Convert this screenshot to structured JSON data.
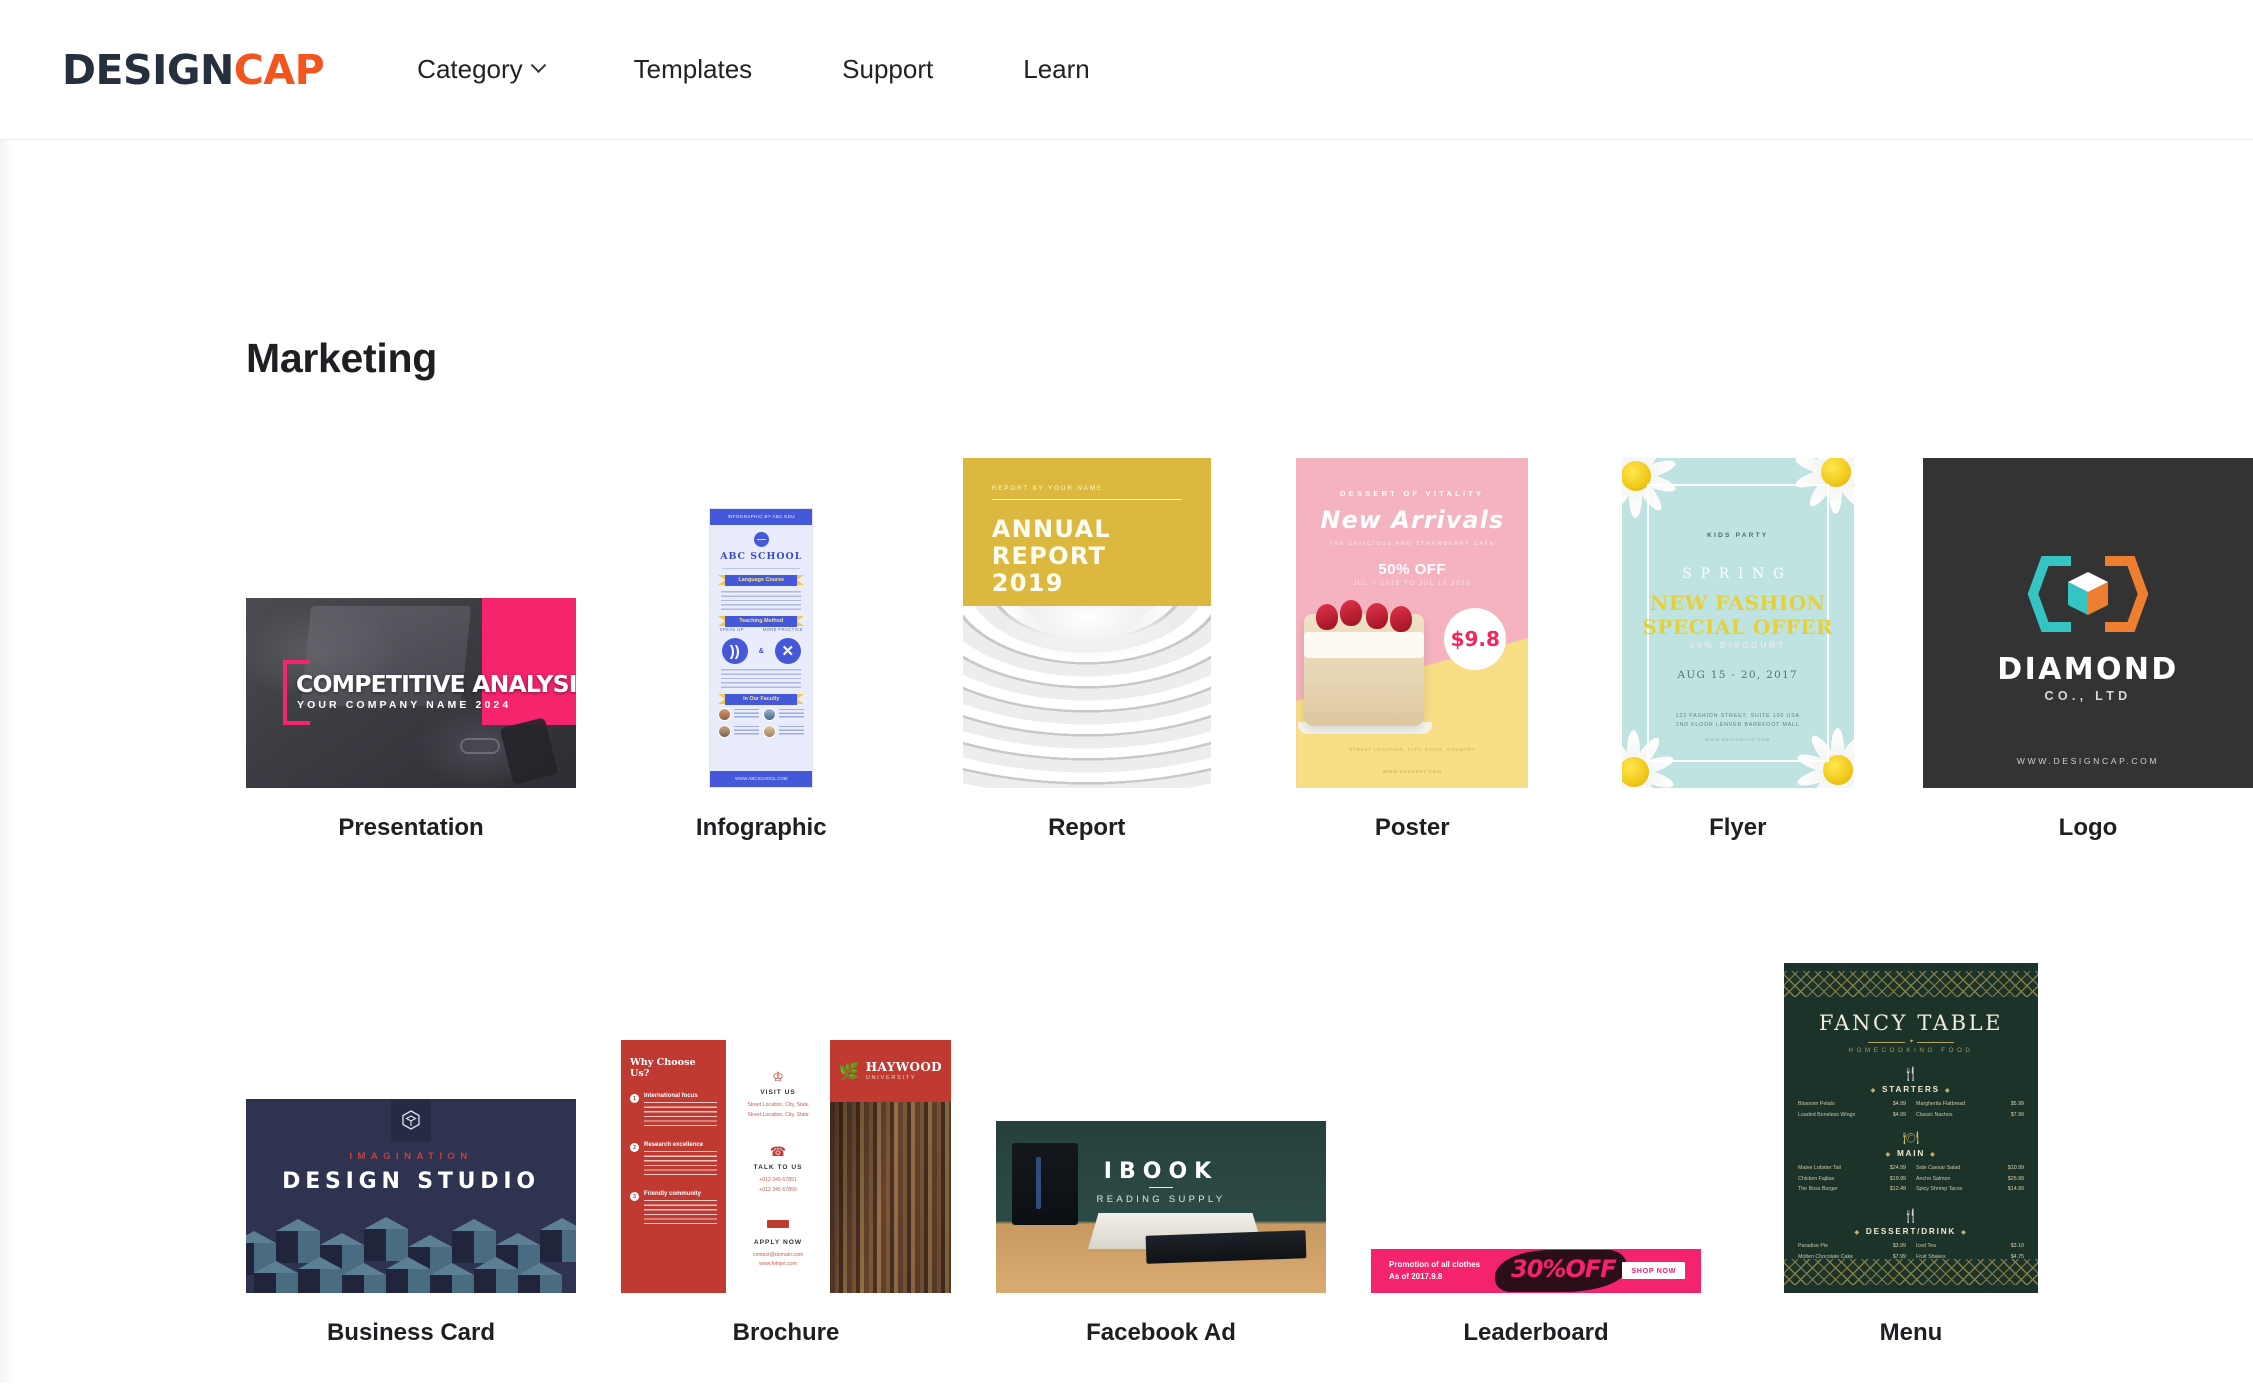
{
  "header": {
    "logo": {
      "part1": "DESIGN",
      "part2": "CAP",
      "color1": "#262f3d",
      "color2": "#f4551f"
    },
    "nav": [
      {
        "label": "Category",
        "has_caret": true
      },
      {
        "label": "Templates",
        "has_caret": false
      },
      {
        "label": "Support",
        "has_caret": false
      },
      {
        "label": "Learn",
        "has_caret": false
      }
    ]
  },
  "main": {
    "section_title": "Marketing",
    "row1": [
      {
        "label": "Presentation"
      },
      {
        "label": "Infographic"
      },
      {
        "label": "Report"
      },
      {
        "label": "Poster"
      },
      {
        "label": "Flyer"
      },
      {
        "label": "Logo"
      }
    ],
    "row2": [
      {
        "label": "Business Card"
      },
      {
        "label": "Brochure"
      },
      {
        "label": "Facebook Ad"
      },
      {
        "label": "Leaderboard"
      },
      {
        "label": "Menu"
      }
    ]
  },
  "thumbs": {
    "presentation": {
      "title": "COMPETITIVE ANALYSIS",
      "subtitle": "YOUR COMPANY NAME 2024",
      "accent": "#f5246d"
    },
    "infographic": {
      "top_bar": "INFOGRAPHIC BY ABC EDU",
      "school": "ABC SCHOOL",
      "tag1": "Language Course",
      "tag2": "Teaching Method",
      "icon_label_left": "SPEAK UP",
      "icon_label_right": "MORE PRACTICE",
      "amp": "&",
      "tag3": "In Our Faculty",
      "bottom_bar": "WWW.ABCSCHOOL.COM",
      "accent": "#4559d8"
    },
    "report": {
      "kicker": "REPORT BY YOUR NAME",
      "line1": "ANNUAL",
      "line2": "REPORT",
      "line3": "2019",
      "accent": "#dcb83f"
    },
    "poster": {
      "kicker": "DESSERT OF VITALITY",
      "headline": "New Arrivals",
      "sub": "THE DELICIOUS AND STRAWBERRY CAKE",
      "offer": "50% OFF",
      "date": "JUL 7 2019   TO   JUL 19 2019",
      "price": "$9.8",
      "foot1": "STREET LOCATION, CITY, STATE, COUNTRY",
      "foot2": "WWW.DESSERT.COM",
      "accent_pink": "#f5b3c0",
      "accent_yellow": "#f8df86"
    },
    "flyer": {
      "kicker": "KIDS PARTY",
      "spring": "SPRING",
      "line1": "NEW FASHION",
      "line2": "SPECIAL OFFER",
      "discount": "50% DISCOUNT",
      "date": "AUG 15 - 20, 2017",
      "address": "123 FASHION STREET, SUITE 100 USA\n2ND FLOOR LENVER BAREFOOT MALL",
      "web": "WWW.DESIGNCAP.COM",
      "accent": "#bfe3e0"
    },
    "logo": {
      "name": "DIAMOND",
      "sub": "CO., LTD",
      "url": "WWW.DESIGNCAP.COM",
      "bg": "#333333",
      "hex_teal": "#35c4c4",
      "hex_orange": "#ee7f30"
    },
    "business_card": {
      "kicker": "IMAGINATION",
      "name": "DESIGN STUDIO",
      "bg": "#2e3350",
      "kicker_color": "#c1453f"
    },
    "brochure": {
      "why": "Why Choose Us?",
      "items": [
        {
          "num": "1",
          "title": "International focus"
        },
        {
          "num": "2",
          "title": "Research excellence"
        },
        {
          "num": "3",
          "title": "Friendly community"
        }
      ],
      "visit_head": "VISIT US",
      "visit_lines": "Street Location, City, State\nStreet Location, City, State",
      "talk_head": "TALK TO US",
      "talk_lines": "+012 345 67891\n+012 345 67890",
      "apply_head": "APPLY NOW",
      "apply_lines": "contact@domain.com\nwww.fotojet.com",
      "uni_name": "HAYWOOD",
      "uni_sub": "UNIVERSITY",
      "accent": "#c03a31"
    },
    "facebook_ad": {
      "title": "IBOOK",
      "sub": "READING SUPPLY"
    },
    "leaderboard": {
      "line1": "Promotion of all clothes",
      "line2": "As of 2017.9.8",
      "offer": "30%OFF",
      "button": "SHOP NOW",
      "accent": "#f3246d"
    },
    "menu": {
      "title": "FANCY TABLE",
      "sub": "HOMECOOKING FOOD",
      "sections": [
        {
          "name": "STARTERS",
          "left": [
            {
              "item": "Blossom Petals",
              "price": "$4.99"
            },
            {
              "item": "Loaded Boneless Wings",
              "price": "$4.99"
            }
          ],
          "right": [
            {
              "item": "Margherita Flatbread",
              "price": "$5.99"
            },
            {
              "item": "Classic Nachos",
              "price": "$7.99"
            }
          ]
        },
        {
          "name": "MAIN",
          "left": [
            {
              "item": "Maine Lobster Tail",
              "price": "$24.99"
            },
            {
              "item": "Chicken Fajitas",
              "price": "$19.99"
            },
            {
              "item": "The Boss Burger",
              "price": "$12.49"
            }
          ],
          "right": [
            {
              "item": "Side Caesar Salad",
              "price": "$10.99"
            },
            {
              "item": "Ancho Salmon",
              "price": "$25.99"
            },
            {
              "item": "Spicy Shrimp Tacos",
              "price": "$14.99"
            }
          ]
        },
        {
          "name": "DESSERT/DRINK",
          "left": [
            {
              "item": "Paradise Pie",
              "price": "$3.99"
            },
            {
              "item": "Molten Chocolate Cake",
              "price": "$7.99"
            }
          ],
          "right": [
            {
              "item": "Iced Tea",
              "price": "$3.10"
            },
            {
              "item": "Fruit Shakes",
              "price": "$4.75"
            }
          ]
        }
      ],
      "bg": "#1b3328",
      "gold": "#b5a463"
    }
  }
}
